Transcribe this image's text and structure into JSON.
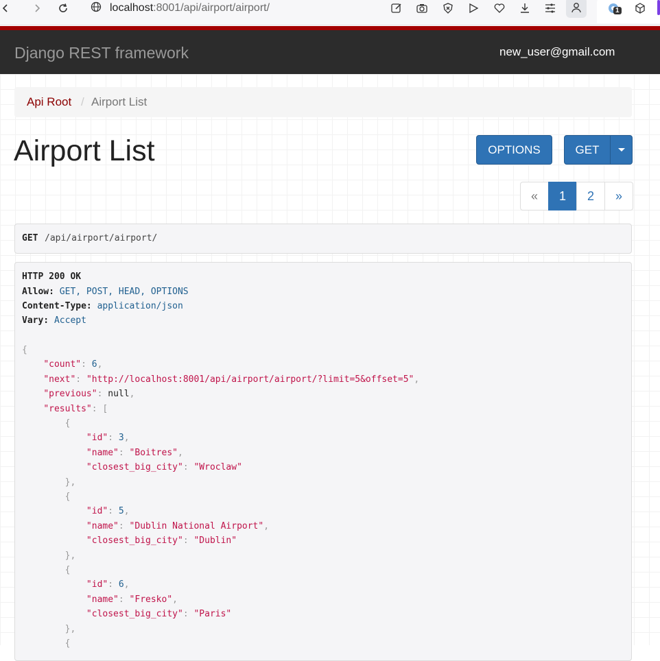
{
  "browser": {
    "url_host": "localhost",
    "url_rest": ":8001/api/airport/airport/",
    "extension_badge": "1"
  },
  "navbar": {
    "brand": "Django REST framework",
    "user": "new_user@gmail.com"
  },
  "breadcrumb": {
    "root": "Api Root",
    "separator": "/",
    "current": "Airport List"
  },
  "page": {
    "title": "Airport List",
    "options_label": "OPTIONS",
    "get_label": "GET"
  },
  "pagination": {
    "prev": "«",
    "pages": [
      "1",
      "2"
    ],
    "active": "1",
    "next": "»"
  },
  "request": {
    "method": "GET",
    "path": "/api/airport/airport/"
  },
  "response": {
    "status": "HTTP 200 OK",
    "headers": [
      {
        "name": "Allow:",
        "value": "GET, POST, HEAD, OPTIONS"
      },
      {
        "name": "Content-Type:",
        "value": "application/json"
      },
      {
        "name": "Vary:",
        "value": "Accept"
      }
    ],
    "count": "6",
    "next": "\"http://localhost:8001/api/airport/airport/?limit=5&offset=5\"",
    "previous": "null",
    "results": [
      {
        "id": "3",
        "name": "\"Boitres\"",
        "city": "\"Wroclaw\""
      },
      {
        "id": "5",
        "name": "\"Dublin National Airport\"",
        "city": "\"Dublin\""
      },
      {
        "id": "6",
        "name": "\"Fresko\"",
        "city": "\"Paris\""
      }
    ]
  },
  "colors": {
    "brand_red": "#a30000",
    "navbar_bg": "#2c2c2c",
    "button_blue": "#2f73b5",
    "json_string": "#c0134a"
  }
}
